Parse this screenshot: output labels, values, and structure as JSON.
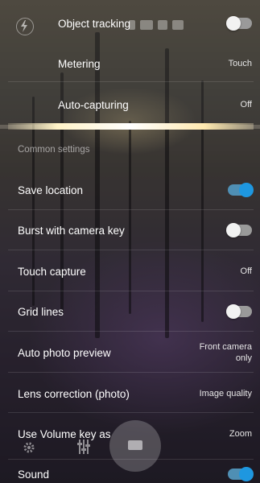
{
  "header": {
    "object_tracking_label": "Object tracking",
    "object_tracking_enabled": false
  },
  "sub_settings": [
    {
      "label": "Metering",
      "value": "Touch"
    },
    {
      "label": "Auto-capturing",
      "value": "Off"
    }
  ],
  "section_header": "Common settings",
  "settings": [
    {
      "label": "Save location",
      "type": "toggle",
      "enabled": true
    },
    {
      "label": "Burst with camera key",
      "type": "toggle",
      "enabled": false
    },
    {
      "label": "Touch capture",
      "type": "value",
      "value": "Off"
    },
    {
      "label": "Grid lines",
      "type": "toggle",
      "enabled": false
    },
    {
      "label": "Auto photo preview",
      "type": "value",
      "value_line1": "Front camera",
      "value_line2": "only"
    },
    {
      "label": "Lens correction (photo)",
      "type": "value",
      "value": "Image quality"
    },
    {
      "label": "Use Volume key as",
      "type": "value",
      "value": "Zoom"
    },
    {
      "label": "Sound",
      "type": "toggle",
      "enabled": true
    }
  ],
  "icons": {
    "flash": "flash-auto-icon",
    "settings": "gear-icon",
    "adjust": "sliders-icon",
    "shutter": "camera-icon"
  },
  "colors": {
    "toggle_on": "#1e97e0",
    "toggle_off": "#f2f2f2"
  }
}
